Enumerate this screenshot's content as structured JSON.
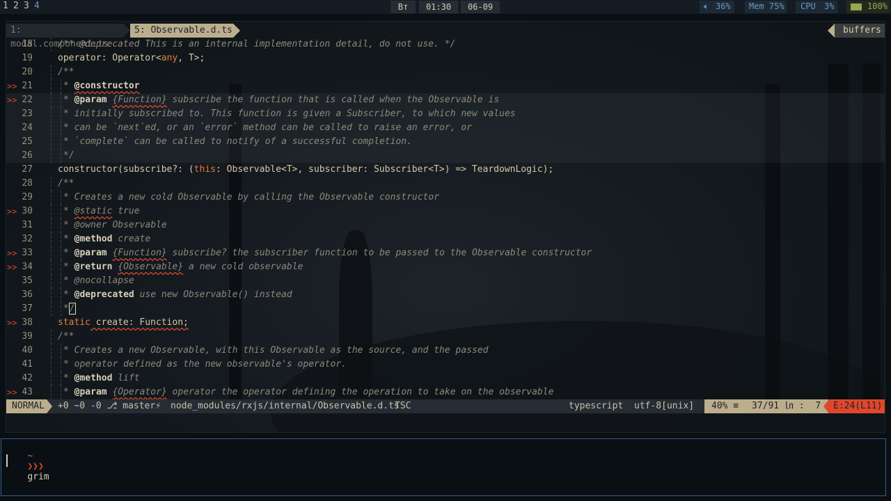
{
  "topbar": {
    "workspaces": [
      "1",
      "2",
      "3",
      "4"
    ],
    "day": "Вт",
    "time": "01:30",
    "date": "06-09",
    "volume": "36%",
    "memory": "Mem 75%",
    "cpu_label": "CPU",
    "cpu_value": "3%",
    "battery": "100%"
  },
  "tabs": {
    "tab1": "1: modal.component.ts",
    "tab2": "5: Observable.d.ts",
    "buffers": "buffers"
  },
  "lines": [
    {
      "n": "18",
      "sign": ""
    },
    {
      "n": "19",
      "sign": ""
    },
    {
      "n": "20",
      "sign": ""
    },
    {
      "n": "21",
      "sign": ">>"
    },
    {
      "n": "22",
      "sign": ">>"
    },
    {
      "n": "23",
      "sign": ""
    },
    {
      "n": "24",
      "sign": ""
    },
    {
      "n": "25",
      "sign": ""
    },
    {
      "n": "26",
      "sign": ""
    },
    {
      "n": "27",
      "sign": ""
    },
    {
      "n": "28",
      "sign": ""
    },
    {
      "n": "29",
      "sign": ""
    },
    {
      "n": "30",
      "sign": ">>"
    },
    {
      "n": "31",
      "sign": ""
    },
    {
      "n": "32",
      "sign": ""
    },
    {
      "n": "33",
      "sign": ">>"
    },
    {
      "n": "34",
      "sign": ">>"
    },
    {
      "n": "35",
      "sign": ""
    },
    {
      "n": "36",
      "sign": ""
    },
    {
      "n": "37",
      "sign": ""
    },
    {
      "n": "38",
      "sign": ">>"
    },
    {
      "n": "39",
      "sign": ""
    },
    {
      "n": "40",
      "sign": ""
    },
    {
      "n": "41",
      "sign": ""
    },
    {
      "n": "42",
      "sign": ""
    },
    {
      "n": "43",
      "sign": ">>"
    }
  ],
  "code": {
    "l18": "/** @deprecated This is an internal implementation detail, do not use. */",
    "l19_a": "operator: Operator<",
    "l19_b": "any",
    "l19_c": ", T>;",
    "l20": "/**",
    "l21_star": "* ",
    "l21_tag": "@constructor",
    "l22_star": "* ",
    "l22_tag": "@param",
    "l22_type": "{Function}",
    "l22_rest": " subscribe the function that is called when the Observable is",
    "l23": "* initially subscribed to. This function is given a Subscriber, to which new values",
    "l24": "* can be `next`ed, or an `error` method can be called to raise an error, or",
    "l25": "* `complete` can be called to notify of a successful completion.",
    "l26": "*/",
    "l27_a": "constructor(subscribe?: (",
    "l27_b": "this",
    "l27_c": ": Observable<T>, subscriber: Subscriber<T>) => TeardownLogic);",
    "l28": "/**",
    "l29": "* Creates a new cold Observable by calling the Observable constructor",
    "l30_star": "* ",
    "l30_tag": "@static",
    "l30_rest": " true",
    "l31": "* @owner Observable",
    "l32_star": "* ",
    "l32_tag": "@method",
    "l32_rest": " create",
    "l33_star": "* ",
    "l33_tag": "@param",
    "l33_type": "{Function}",
    "l33_rest": " subscribe? the subscriber function to be passed to the Observable constructor",
    "l34_star": "* ",
    "l34_tag": "@return",
    "l34_type": "{Observable}",
    "l34_rest": " a new cold observable",
    "l35": "* @nocollapse",
    "l36_star": "* ",
    "l36_tag": "@deprecated",
    "l36_rest": " use new Observable() instead",
    "l37_a": "*",
    "l37_b": "/",
    "l38_a": "static",
    "l38_b": " create: Function;",
    "l39": "/**",
    "l40": "* Creates a new Observable, with this Observable as the source, and the passed",
    "l41": "* operator defined as the new observable's operator.",
    "l42_star": "* ",
    "l42_tag": "@method",
    "l42_rest": " lift",
    "l43_star": "* ",
    "l43_tag": "@param",
    "l43_type": "{Operator}",
    "l43_rest": " operator the operator defining the operation to take on the observable"
  },
  "status": {
    "mode": "NORMAL",
    "git": "+0 ~0 -0 ⎇ master⚡",
    "file": "node_modules/rxjs/internal/Observable.d.ts",
    "tsc": "TSC",
    "filetype": "typescript",
    "encoding": "utf-8[unix]",
    "percent": "40% ≡",
    "position": "37/91 ㏑ :  7",
    "errors": "E:24(L11)"
  },
  "terminal": {
    "prompt_dir": "~",
    "prompt_arrows": "❯❯❯",
    "command": "grim"
  },
  "colors": {
    "accent_tan": "#bcae8d",
    "error_red": "#e0472a",
    "keyword_orange": "#e47d38",
    "bar_blue": "#6d95c4",
    "battery_green": "#98a650"
  }
}
